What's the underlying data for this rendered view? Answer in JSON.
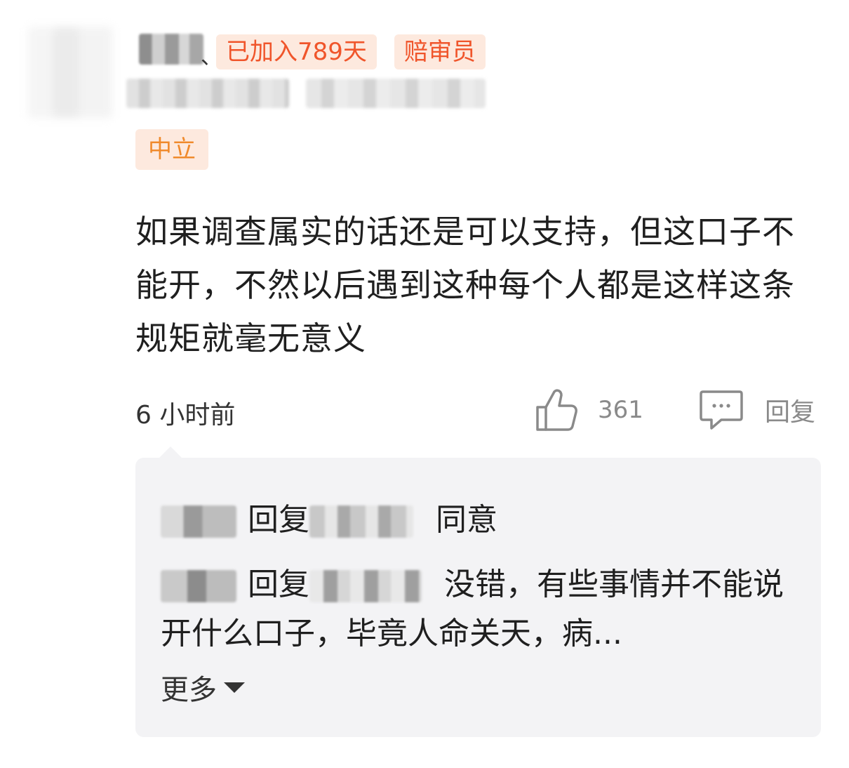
{
  "header": {
    "badges": [
      {
        "label": "已加入789天",
        "icon": "days-joined-badge"
      },
      {
        "label": "赔审员",
        "icon": "juror-badge"
      }
    ],
    "separator": "、",
    "stance": "中立",
    "colors": {
      "badge_bg": "#fde9de",
      "badge_text": "#f0552b",
      "stance_text": "#f08a2c"
    }
  },
  "comment": {
    "text": "如果调查属实的话还是可以支持，但这口子不能开，不然以后遇到这种每个人都是这样这条规矩就毫无意义",
    "time": "6 小时前",
    "likes": "361",
    "reply_label": "回复"
  },
  "replies": {
    "items": [
      {
        "verb": "回复",
        "text": "同意"
      },
      {
        "verb": "回复",
        "text": "没错，有些事情并不能说开什么口子，毕竟人命关天，病..."
      }
    ],
    "more_label": "更多"
  }
}
